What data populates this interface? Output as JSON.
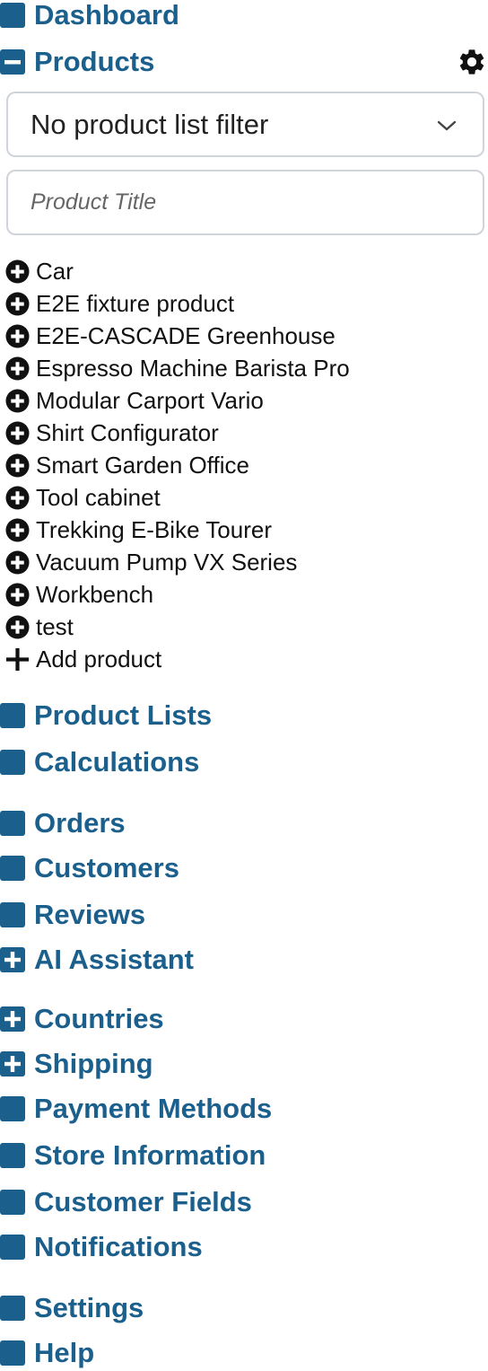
{
  "nav": {
    "dashboard": "Dashboard",
    "products": "Products",
    "product_lists": "Product Lists",
    "calculations": "Calculations",
    "orders": "Orders",
    "customers": "Customers",
    "reviews": "Reviews",
    "ai_assistant": "AI Assistant",
    "countries": "Countries",
    "shipping": "Shipping",
    "payment_methods": "Payment Methods",
    "store_information": "Store Information",
    "customer_fields": "Customer Fields",
    "notifications": "Notifications",
    "settings": "Settings",
    "help": "Help"
  },
  "products_panel": {
    "filter_selected": "No product list filter",
    "title_placeholder": "Product Title",
    "items": [
      "Car",
      "E2E fixture product",
      "E2E-CASCADE Greenhouse",
      "Espresso Machine Barista Pro",
      "Modular Carport Vario",
      "Shirt Configurator",
      "Smart Garden Office",
      "Tool cabinet",
      "Trekking E-Bike Tourer",
      "Vacuum Pump VX Series",
      "Workbench",
      "test"
    ],
    "add_label": "Add product"
  },
  "colors": {
    "accent": "#1b5f8c",
    "icon_square": "#1b5f8c",
    "text": "#111111",
    "input_border": "#cfd4da"
  },
  "icons": {
    "collapsed_section": "square-icon",
    "expanded_section": "minus-square-icon",
    "expandable_section": "plus-square-icon",
    "settings": "gear-icon",
    "expand_product": "plus-circle-icon",
    "add": "plus-icon",
    "dropdown": "chevron-down-icon"
  }
}
